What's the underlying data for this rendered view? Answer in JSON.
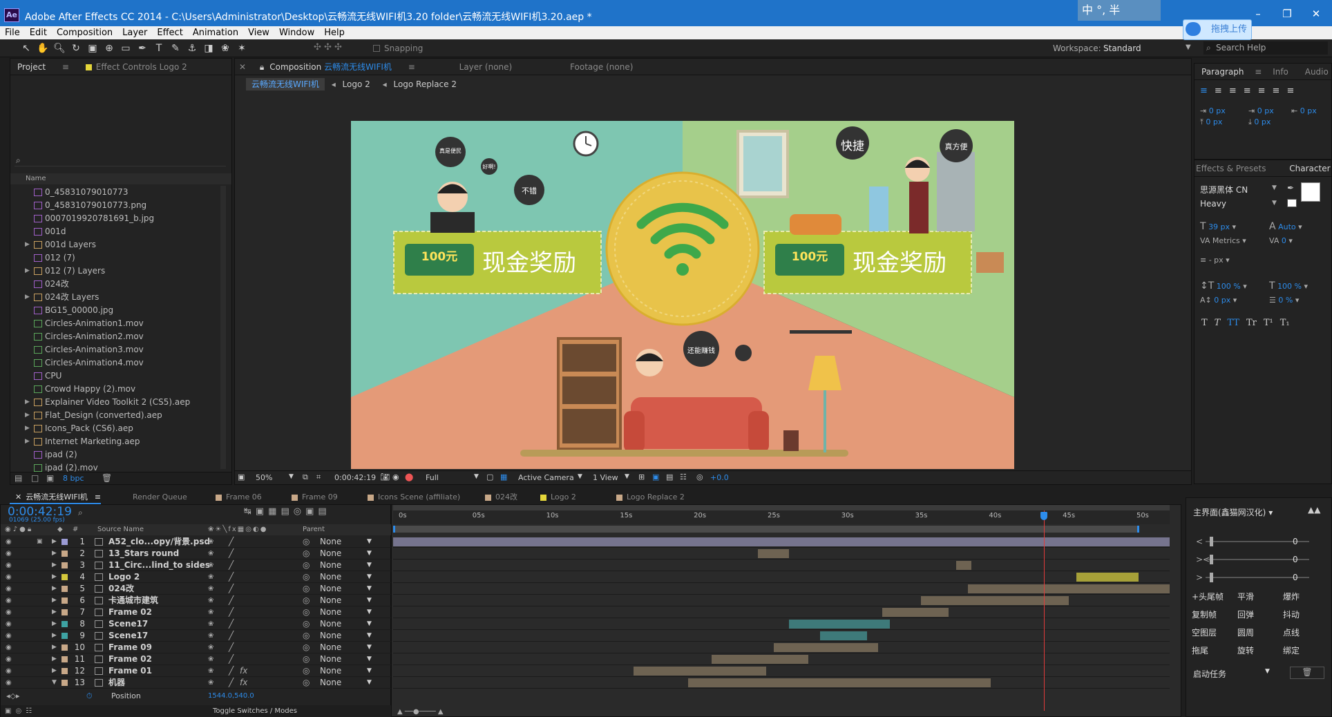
{
  "window": {
    "app_icon": "Ae",
    "title": "Adobe After Effects CC 2014 - C:\\Users\\Administrator\\Desktop\\云畅流无线WIFI机3.20 folder\\云畅流无线WIFI机3.20.aep *",
    "min": "–",
    "max": "❐",
    "close": "✕",
    "overlay_label": "拖拽上传",
    "ime_text": "中 °, 半"
  },
  "menu": [
    "File",
    "Edit",
    "Composition",
    "Layer",
    "Effect",
    "Animation",
    "View",
    "Window",
    "Help"
  ],
  "toolbar": {
    "snapping": "Snapping",
    "workspace_label": "Workspace:",
    "workspace_value": "Standard",
    "search_placeholder": "Search Help"
  },
  "project": {
    "tab_project": "Project",
    "tab_effect": "Effect Controls Logo 2",
    "name_col": "Name",
    "bpc": "8 bpc",
    "items": [
      {
        "name": "0_45831079010773",
        "type": "file",
        "expand": false
      },
      {
        "name": "0_45831079010773.png",
        "type": "file",
        "expand": false
      },
      {
        "name": "0007019920781691_b.jpg",
        "type": "file",
        "expand": false
      },
      {
        "name": "001d",
        "type": "file",
        "expand": false
      },
      {
        "name": "001d Layers",
        "type": "folder",
        "expand": true
      },
      {
        "name": "012 (7)",
        "type": "file",
        "expand": false
      },
      {
        "name": "012 (7) Layers",
        "type": "folder",
        "expand": true
      },
      {
        "name": "024改",
        "type": "file",
        "expand": false
      },
      {
        "name": "024改 Layers",
        "type": "folder",
        "expand": true
      },
      {
        "name": "BG15_00000.jpg",
        "type": "file",
        "expand": false
      },
      {
        "name": "Circles-Animation1.mov",
        "type": "mov",
        "expand": false
      },
      {
        "name": "Circles-Animation2.mov",
        "type": "mov",
        "expand": false
      },
      {
        "name": "Circles-Animation3.mov",
        "type": "mov",
        "expand": false
      },
      {
        "name": "Circles-Animation4.mov",
        "type": "mov",
        "expand": false
      },
      {
        "name": "CPU",
        "type": "file",
        "expand": false
      },
      {
        "name": "Crowd Happy (2).mov",
        "type": "mov",
        "expand": false
      },
      {
        "name": "Explainer Video Toolkit 2 (CS5).aep",
        "type": "folder",
        "expand": true
      },
      {
        "name": "Flat_Design (converted).aep",
        "type": "folder",
        "expand": true
      },
      {
        "name": "Icons_Pack (CS6).aep",
        "type": "folder",
        "expand": true
      },
      {
        "name": "Internet Marketing.aep",
        "type": "folder",
        "expand": true
      },
      {
        "name": "ipad (2)",
        "type": "file",
        "expand": false
      },
      {
        "name": "ipad (2).mov",
        "type": "mov",
        "expand": false
      }
    ]
  },
  "comp": {
    "tab_comp_prefix": "Composition",
    "tab_comp_name": "云畅流无线WIFI机",
    "tab_layer": "Layer (none)",
    "tab_footage": "Footage (none)",
    "breadcrumbs": [
      "云畅流无线WIFI机",
      "Logo 2",
      "Logo Replace 2"
    ],
    "footer": {
      "zoom": "50%",
      "timecode": "0:00:42:19",
      "resolution": "Full",
      "camera": "Active Camera",
      "view": "1 View",
      "exposure": "+0.0"
    },
    "scene": {
      "banner_badge": "100元",
      "banner_text": "现金奖励",
      "bubble1": "真是便民",
      "bubble2": "好啊!",
      "bubble3": "不错",
      "bubble4": "快捷",
      "bubble5": "真方便",
      "bubble6": "还能赚钱"
    }
  },
  "right": {
    "tab_paragraph": "Paragraph",
    "tab_info": "Info",
    "tab_audio": "Audio",
    "para_px": "0 px",
    "tab_effects": "Effects & Presets",
    "tab_character": "Character",
    "font": "思源黑体 CN",
    "style": "Heavy",
    "size": "39 px",
    "leading": "Auto",
    "kerning": "Metrics",
    "tracking": "0",
    "stroke": "- px",
    "vscale": "100 %",
    "hscale": "100 %",
    "baseline": "0 px",
    "tsume": "0 %",
    "text_styles": [
      "T",
      "T",
      "TT",
      "Tr",
      "T¹",
      "T₁"
    ]
  },
  "timeline": {
    "tabs": [
      "云畅流无线WIFI机",
      "Render Queue",
      "Frame 06",
      "Frame 09",
      "Icons Scene (affiliate)",
      "024改",
      "Logo 2",
      "Logo Replace 2"
    ],
    "timecode": "0:00:42:19",
    "fps": "01069 (25.00 fps)",
    "col_source": "Source Name",
    "col_parent": "Parent",
    "toggle": "Toggle Switches / Modes",
    "ruler": [
      "0s",
      "05s",
      "10s",
      "15s",
      "20s",
      "25s",
      "30s",
      "35s",
      "40s",
      "45s",
      "50s"
    ],
    "layers": [
      {
        "num": "1",
        "name": "A52_clo...opy/背景.psd",
        "color": "#9b9bd4",
        "bar": [
          0,
          100
        ],
        "type": "full"
      },
      {
        "num": "2",
        "name": "13_Stars round",
        "color": "#c8a888",
        "bar": [
          47,
          51
        ],
        "type": "n"
      },
      {
        "num": "3",
        "name": "11_Circ...lind_to sides",
        "color": "#c8a888",
        "bar": [
          72.5,
          74.5
        ],
        "type": "n"
      },
      {
        "num": "4",
        "name": "Logo 2",
        "color": "#d4c83c",
        "bar": [
          88,
          96
        ],
        "type": "y"
      },
      {
        "num": "5",
        "name": "024改",
        "color": "#c8a888",
        "bar": [
          74,
          100
        ],
        "type": "n"
      },
      {
        "num": "6",
        "name": "卡通城市建筑",
        "color": "#c8a888",
        "bar": [
          68,
          87
        ],
        "type": "n"
      },
      {
        "num": "7",
        "name": "Frame 02",
        "color": "#c8a888",
        "bar": [
          63,
          71.5
        ],
        "type": "n"
      },
      {
        "num": "8",
        "name": "Scene17",
        "color": "#3ea3a3",
        "bar": [
          51,
          64
        ],
        "type": "b"
      },
      {
        "num": "9",
        "name": "Scene17",
        "color": "#3ea3a3",
        "bar": [
          55,
          61
        ],
        "type": "b"
      },
      {
        "num": "10",
        "name": "Frame 09",
        "color": "#c8a888",
        "bar": [
          49,
          62.5
        ],
        "type": "n"
      },
      {
        "num": "11",
        "name": "Frame 02",
        "color": "#c8a888",
        "bar": [
          41,
          53.5
        ],
        "type": "n"
      },
      {
        "num": "12",
        "name": "Frame 01",
        "color": "#c8a888",
        "bar": [
          31,
          48
        ],
        "type": "n"
      },
      {
        "num": "13",
        "name": "机器",
        "color": "#c8a888",
        "bar": [
          38,
          77
        ],
        "type": "n"
      }
    ],
    "position_label": "Position",
    "position_value": "1544.0,540.0",
    "parent_value": "None",
    "playhead_pct": 83.8
  },
  "tools_panel": {
    "title": "主界面(鑫猫网汉化)",
    "values": [
      "0",
      "0",
      "0"
    ],
    "buttons": [
      "+头尾帧",
      "平滑",
      "爆炸",
      "复制帧",
      "回弹",
      "抖动",
      "空图层",
      "圆周",
      "点线",
      "拖尾",
      "旋转",
      "绑定"
    ],
    "task": "启动任务"
  }
}
